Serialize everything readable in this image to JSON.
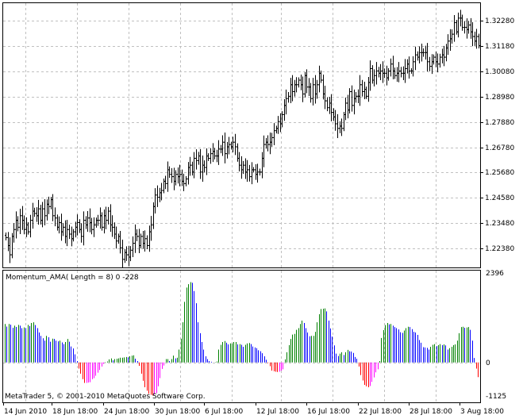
{
  "terminal": {
    "copyright": "MetaTrader 5, © 2001-2010 MetaQuotes Software Corp."
  },
  "price_chart": {
    "price_ticks": [
      "1.32280",
      "1.31180",
      "1.30080",
      "1.28980",
      "1.27880",
      "1.26780",
      "1.25680",
      "1.24580",
      "1.23480",
      "1.22380"
    ]
  },
  "indicator": {
    "label": "Momentum_AMA( Length = 8) 0 -228",
    "ticks": [
      "2396",
      "0",
      "-1125"
    ]
  },
  "time_axis": {
    "labels": [
      "14 Jun 2010",
      "18 Jun 18:00",
      "24 Jun 18:00",
      "30 Jun 18:00",
      "6 Jul 18:00",
      "12 Jul 18:00",
      "16 Jul 18:00",
      "22 Jul 18:00",
      "28 Jul 18:00",
      "3 Aug 18:00"
    ]
  },
  "colors": {
    "background": "#ffffff",
    "grid": "#c0c0c0",
    "price_bars": "#000000",
    "rising_positive": "#008000",
    "falling_positive": "#0000ff",
    "falling_negative": "#ff0000",
    "rising_negative": "#ff00ff"
  },
  "chart_data": [
    {
      "type": "ohlc",
      "ylim": [
        1.2155,
        1.3305
      ],
      "close": [
        1.2285,
        1.225,
        1.221,
        1.229,
        1.232,
        1.236,
        1.233,
        1.238,
        1.236,
        1.232,
        1.234,
        1.231,
        1.236,
        1.24,
        1.239,
        1.238,
        1.241,
        1.236,
        1.241,
        1.238,
        1.243,
        1.242,
        1.245,
        1.238,
        1.237,
        1.233,
        1.235,
        1.231,
        1.233,
        1.229,
        1.232,
        1.23,
        1.228,
        1.231,
        1.233,
        1.235,
        1.232,
        1.229,
        1.236,
        1.234,
        1.237,
        1.235,
        1.232,
        1.234,
        1.236,
        1.236,
        1.238,
        1.233,
        1.238,
        1.236,
        1.24,
        1.234,
        1.233,
        1.23,
        1.227,
        1.229,
        1.224,
        1.219,
        1.222,
        1.221,
        1.22,
        1.223,
        1.226,
        1.23,
        1.229,
        1.225,
        1.229,
        1.226,
        1.228,
        1.225,
        1.231,
        1.234,
        1.242,
        1.247,
        1.246,
        1.248,
        1.249,
        1.253,
        1.252,
        1.258,
        1.256,
        1.255,
        1.253,
        1.256,
        1.255,
        1.256,
        1.253,
        1.252,
        1.254,
        1.259,
        1.26,
        1.257,
        1.263,
        1.262,
        1.264,
        1.257,
        1.26,
        1.259,
        1.264,
        1.263,
        1.265,
        1.266,
        1.264,
        1.264,
        1.267,
        1.267,
        1.27,
        1.265,
        1.268,
        1.269,
        1.268,
        1.27,
        1.268,
        1.263,
        1.26,
        1.258,
        1.26,
        1.257,
        1.258,
        1.255,
        1.258,
        1.258,
        1.256,
        1.257,
        1.257,
        1.263,
        1.269,
        1.27,
        1.269,
        1.27,
        1.272,
        1.275,
        1.276,
        1.279,
        1.278,
        1.282,
        1.286,
        1.289,
        1.29,
        1.295,
        1.292,
        1.295,
        1.295,
        1.297,
        1.295,
        1.291,
        1.299,
        1.294,
        1.294,
        1.289,
        1.295,
        1.291,
        1.295,
        1.3,
        1.297,
        1.291,
        1.288,
        1.285,
        1.287,
        1.283,
        1.281,
        1.278,
        1.276,
        1.277,
        1.276,
        1.282,
        1.287,
        1.284,
        1.292,
        1.286,
        1.289,
        1.29,
        1.29,
        1.295,
        1.292,
        1.293,
        1.29,
        1.296,
        1.302,
        1.297,
        1.299,
        1.301,
        1.3,
        1.301,
        1.3,
        1.3,
        1.298,
        1.301,
        1.304,
        1.301,
        1.299,
        1.3,
        1.301,
        1.3,
        1.3,
        1.302,
        1.304,
        1.301,
        1.301,
        1.305,
        1.308,
        1.307,
        1.309,
        1.309,
        1.309,
        1.309,
        1.305,
        1.303,
        1.305,
        1.307,
        1.305,
        1.304,
        1.307,
        1.308,
        1.307,
        1.311,
        1.314,
        1.315,
        1.317,
        1.322,
        1.318,
        1.324,
        1.324,
        1.32,
        1.32,
        1.319,
        1.321,
        1.318,
        1.316,
        1.314,
        1.316,
        1.312
      ]
    },
    {
      "type": "histogram",
      "ylim": [
        -1125,
        2396
      ],
      "values": [
        1130,
        1055,
        1130,
        1110,
        1020,
        1080,
        1045,
        1105,
        1080,
        1010,
        1030,
        1010,
        1105,
        1070,
        1160,
        1180,
        1100,
        1010,
        880,
        780,
        710,
        640,
        780,
        740,
        610,
        700,
        690,
        640,
        620,
        640,
        590,
        540,
        600,
        690,
        610,
        470,
        410,
        240,
        40,
        -180,
        -330,
        -490,
        -600,
        -600,
        -590,
        -580,
        -490,
        -460,
        -390,
        -300,
        -220,
        -120,
        -40,
        10,
        30,
        90,
        120,
        60,
        100,
        110,
        120,
        140,
        140,
        150,
        160,
        150,
        180,
        200,
        210,
        110,
        40,
        -100,
        -330,
        -540,
        -730,
        -830,
        -920,
        -950,
        -970,
        -940,
        -900,
        -700,
        -460,
        -190,
        -90,
        100,
        100,
        40,
        100,
        200,
        120,
        140,
        380,
        700,
        1180,
        1780,
        2200,
        2300,
        2360,
        2340,
        2100,
        1740,
        1180,
        860,
        600,
        380,
        180,
        100,
        40,
        20,
        0,
        10,
        30,
        380,
        520,
        600,
        630,
        580,
        530,
        560,
        560,
        600,
        600,
        530,
        540,
        520,
        460,
        520,
        560,
        570,
        540,
        470,
        440,
        420,
        360,
        330,
        270,
        180,
        80,
        -20,
        -110,
        -240,
        -260,
        -270,
        -280,
        -270,
        -240,
        -200,
        90,
        300,
        510,
        690,
        820,
        840,
        960,
        1010,
        1130,
        1230,
        1160,
        1010,
        880,
        770,
        780,
        780,
        900,
        1180,
        1420,
        1570,
        1580,
        1590,
        1500,
        1230,
        1000,
        760,
        500,
        260,
        190,
        260,
        300,
        220,
        300,
        370,
        330,
        320,
        280,
        160,
        110,
        -120,
        -370,
        -530,
        -660,
        -700,
        -730,
        -690,
        -570,
        -440,
        -290,
        -200,
        40,
        720,
        950,
        1100,
        1160,
        1120,
        1130,
        1080,
        1040,
        1010,
        970,
        890,
        870,
        940,
        1010,
        1050,
        1040,
        980,
        900,
        880,
        810,
        660,
        580,
        450,
        440,
        430,
        380,
        460,
        520,
        540,
        480,
        510,
        540,
        510,
        530,
        500,
        380,
        420,
        460,
        510,
        530,
        640,
        860,
        1040,
        1050,
        1020,
        1030,
        1040,
        960,
        640,
        130,
        -180,
        -430
      ]
    }
  ]
}
